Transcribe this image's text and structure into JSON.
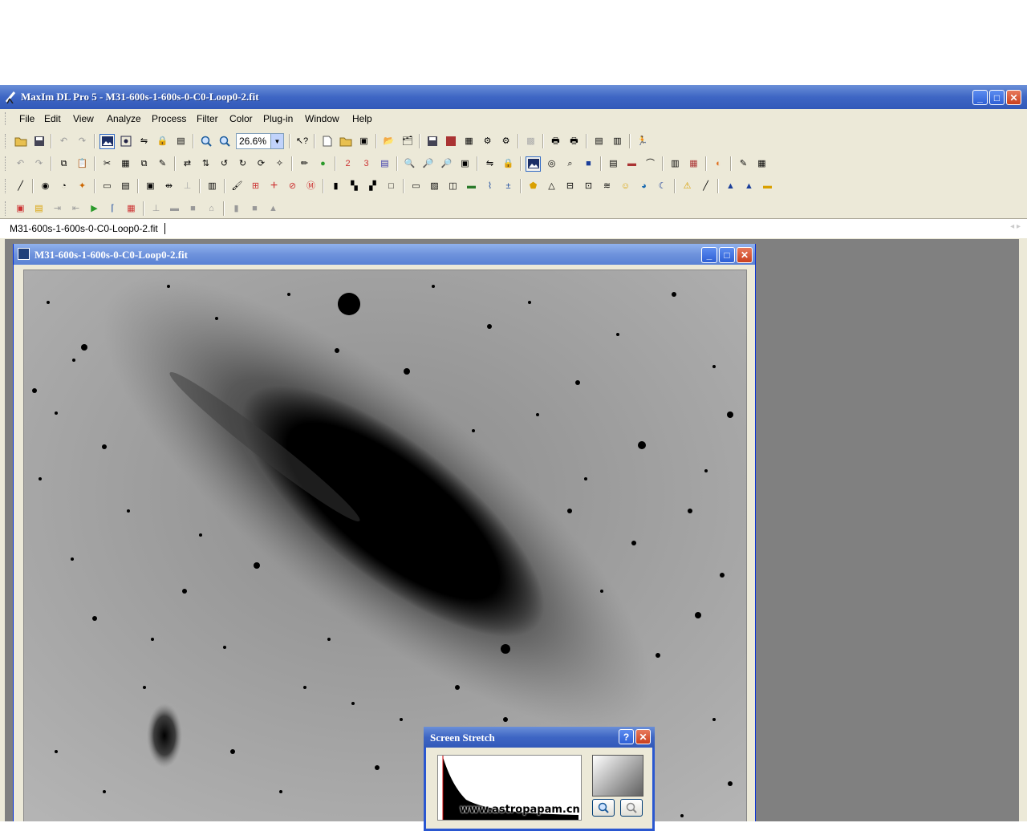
{
  "app": {
    "title": "MaxIm DL Pro 5 - M31-600s-1-600s-0-C0-Loop0-2.fit"
  },
  "window_controls": {
    "minimize": "_",
    "maximize": "□",
    "close": "✕"
  },
  "menu": [
    {
      "label": "File"
    },
    {
      "label": "Edit"
    },
    {
      "label": "View"
    },
    {
      "label": "Analyze"
    },
    {
      "label": "Process"
    },
    {
      "label": "Filter"
    },
    {
      "label": "Color"
    },
    {
      "label": "Plug-in"
    },
    {
      "label": "Window"
    },
    {
      "label": "Help"
    }
  ],
  "toolbar": {
    "zoom_value": "26.6%"
  },
  "tabs": {
    "active": "M31-600s-1-600s-0-C0-Loop0-2.fit"
  },
  "document": {
    "title": "M31-600s-1-600s-0-C0-Loop0-2.fit",
    "image_description": "inverted grayscale image of galaxy M31"
  },
  "dialog": {
    "title": "Screen Stretch",
    "help_label": "?",
    "close_label": "✕"
  },
  "watermark": "www.astropapam.cn",
  "colors": {
    "title_bar": "#3e66c4",
    "chrome": "#ece9d8",
    "mdi_background": "#808080"
  }
}
